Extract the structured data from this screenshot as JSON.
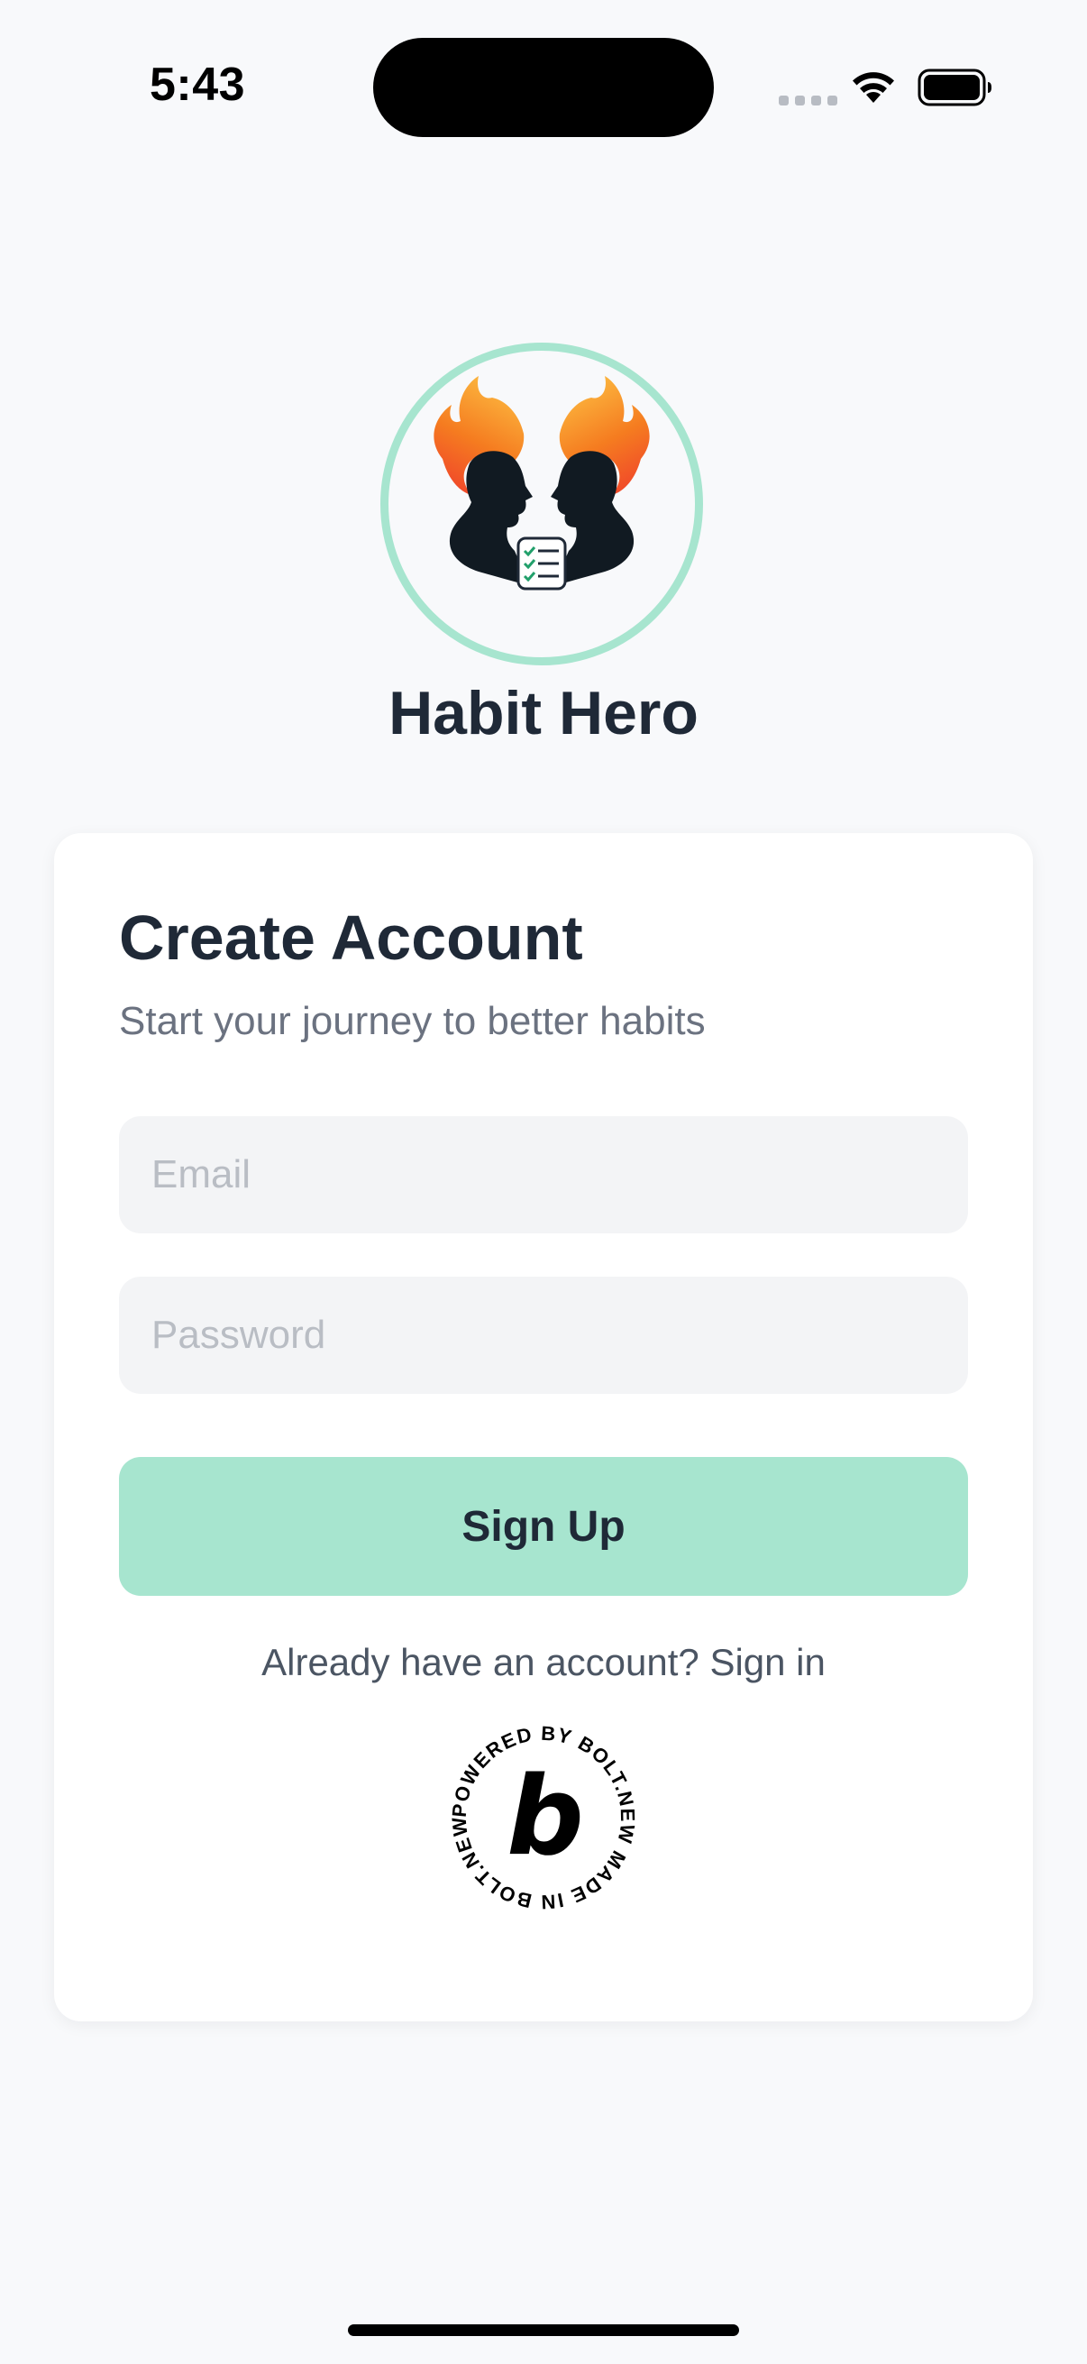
{
  "status_bar": {
    "time": "5:43"
  },
  "app": {
    "title": "Habit Hero",
    "logo_icon": "twin-silhouettes-flame-checklist-logo"
  },
  "card": {
    "title": "Create Account",
    "subtitle": "Start your journey to better habits",
    "email": {
      "value": "",
      "placeholder": "Email"
    },
    "password": {
      "value": "",
      "placeholder": "Password"
    },
    "signup_label": "Sign Up",
    "signin_text": "Already have an account? Sign in",
    "badge": {
      "ring_text": "POWERED BY BOLT.NEW MADE IN BOLT.NEW ",
      "letter": "b"
    }
  },
  "colors": {
    "accent": "#a7e5cf",
    "text_dark": "#1f2937",
    "text_muted": "#6b7280",
    "background": "#f8f9fb",
    "input_bg": "#f3f4f6"
  }
}
